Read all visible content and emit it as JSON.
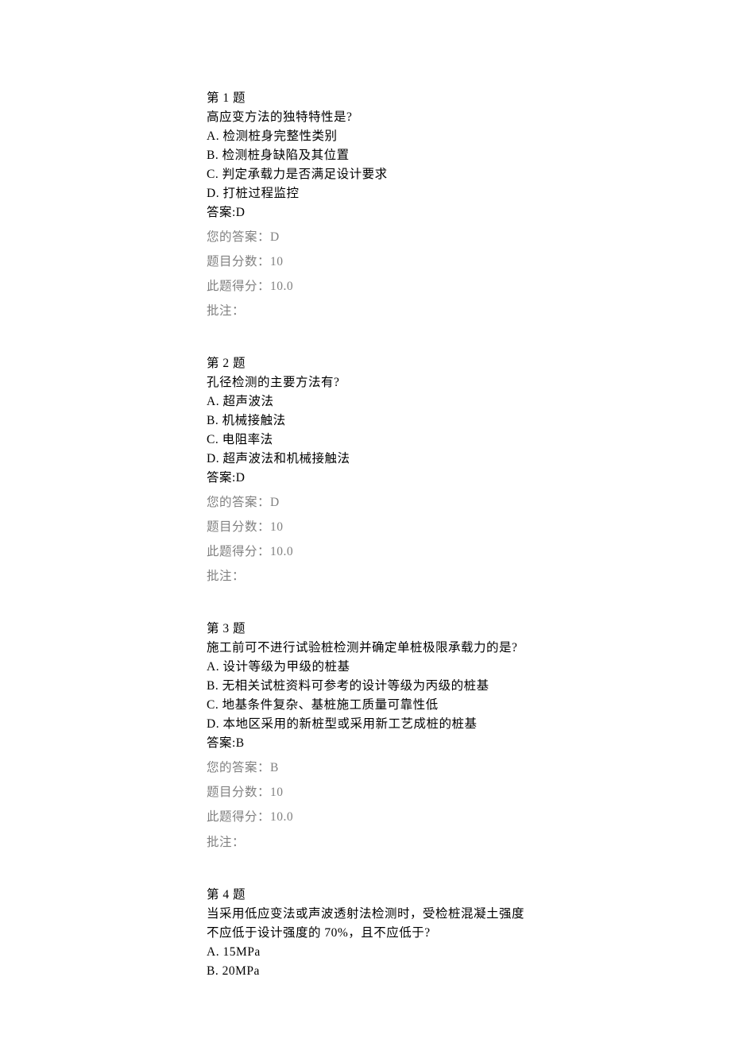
{
  "questions": [
    {
      "header": "第 1 题",
      "prompt": "高应变方法的独特特性是?",
      "options": [
        "A. 检测桩身完整性类别",
        "B. 检测桩身缺陷及其位置",
        "C. 判定承载力是否满足设计要求",
        "D. 打桩过程监控"
      ],
      "answer_label": "答案:D",
      "your_answer_label": "您的答案：D",
      "points_label": "题目分数：10",
      "score_label": "此题得分：10.0",
      "comment_label": "批注："
    },
    {
      "header": "第 2 题",
      "prompt": "孔径检测的主要方法有?",
      "options": [
        "A. 超声波法",
        "B. 机械接触法",
        "C. 电阻率法",
        "D. 超声波法和机械接触法"
      ],
      "answer_label": "答案:D",
      "your_answer_label": "您的答案：D",
      "points_label": "题目分数：10",
      "score_label": "此题得分：10.0",
      "comment_label": "批注："
    },
    {
      "header": "第 3 题",
      "prompt": "施工前可不进行试验桩检测并确定单桩极限承载力的是?",
      "options": [
        "A. 设计等级为甲级的桩基",
        "B. 无相关试桩资料可参考的设计等级为丙级的桩基",
        "C. 地基条件复杂、基桩施工质量可靠性低",
        "D. 本地区采用的新桩型或采用新工艺成桩的桩基"
      ],
      "answer_label": "答案:B",
      "your_answer_label": "您的答案：B",
      "points_label": "题目分数：10",
      "score_label": "此题得分：10.0",
      "comment_label": "批注："
    },
    {
      "header": "第 4 题",
      "prompt": "当采用低应变法或声波透射法检测时，受检桩混凝土强度不应低于设计强度的 70%，且不应低于?",
      "options": [
        "A. 15MPa",
        "B. 20MPa"
      ],
      "answer_label": "",
      "your_answer_label": "",
      "points_label": "",
      "score_label": "",
      "comment_label": ""
    }
  ]
}
